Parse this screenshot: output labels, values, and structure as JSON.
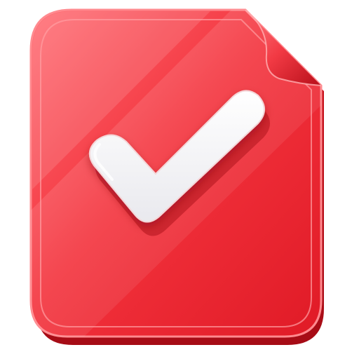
{
  "icon": {
    "name": "document-checkmark-icon",
    "colors": {
      "body": "#f2323c",
      "body_light": "#ff6b72",
      "body_dark": "#c8101c",
      "rim": "#ff8a8f",
      "check": "#ffffff",
      "check_shadow": "#b0121c"
    }
  }
}
